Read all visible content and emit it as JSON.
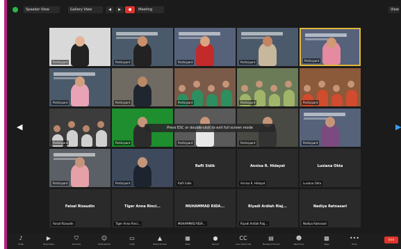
{
  "topbar": {
    "speaker_view_label": "Speaker View",
    "gallery_view_label": "Gallery View",
    "prev_label": "◀",
    "next_label": "▶",
    "record_label": "●",
    "meeting_label": "Meeting",
    "view_label": "View"
  },
  "notice": "Press ESC or double-click to exit full screen mode",
  "navigation": {
    "left": "◀",
    "right": "▶"
  },
  "tiles": [
    {
      "name": "Participant",
      "kind": "video",
      "bg": "#d9d9d9",
      "person": "#222222",
      "head": "#e3b597"
    },
    {
      "name": "Participant",
      "kind": "banner",
      "bg": "#4b5a6b",
      "person": "#222222",
      "head": "#c98f6b"
    },
    {
      "name": "Participant",
      "kind": "banner",
      "bg": "#55627a",
      "person": "#c32a2a",
      "head": "#d9a47f"
    },
    {
      "name": "Participant",
      "kind": "banner",
      "bg": "#4b5a6b",
      "person": "#c7b79c",
      "head": "#c48461"
    },
    {
      "name": "Participant",
      "kind": "banner",
      "bg": "#55627a",
      "person": "#e58aa0",
      "head": "#d09a74",
      "active": true
    },
    {
      "name": "Participant",
      "kind": "banner",
      "bg": "#4b5a6b",
      "person": "#e9a3b6",
      "head": "#d3a07e"
    },
    {
      "name": "Participant",
      "kind": "video",
      "bg": "#6f6a62",
      "person": "#1f2630",
      "head": "#b98866"
    },
    {
      "name": "Participant",
      "kind": "group",
      "bg": "#7a5a48",
      "person": "#2d8f5f",
      "head": "#c5957a"
    },
    {
      "name": "Participant",
      "kind": "group",
      "bg": "#6b7b58",
      "person": "#a0b56a",
      "head": "#c5957a"
    },
    {
      "name": "Participant",
      "kind": "group",
      "bg": "#8a5a3a",
      "person": "#d14b2f",
      "head": "#c5957a"
    },
    {
      "name": "Participant",
      "kind": "group",
      "bg": "#3c3c3c",
      "person": "#d0d0d0",
      "head": "#b8876b"
    },
    {
      "name": "Participant",
      "kind": "video",
      "bg": "#1e8e2e",
      "person": "#2c2c2c",
      "head": "#c5957a"
    },
    {
      "name": "Participant",
      "kind": "video",
      "bg": "#5a5a5a",
      "person": "#e8e8e8",
      "head": "#c5957a"
    },
    {
      "name": "Participant",
      "kind": "video",
      "bg": "#4a4a44",
      "person": "#333333",
      "head": "#c5957a"
    },
    {
      "name": "Participant",
      "kind": "banner",
      "bg": "#55627a",
      "person": "#7b4a7e",
      "head": "#c5957a"
    },
    {
      "name": "Participant",
      "kind": "banner",
      "bg": "#5b5f66",
      "person": "#e5a0a8",
      "head": "#c5957a"
    },
    {
      "name": "Participant",
      "kind": "video",
      "bg": "#3e4a5c",
      "person": "#1d2430",
      "head": "#c5957a"
    },
    {
      "name": "Rafli Sidik",
      "kind": "name"
    },
    {
      "name": "Annisa R. Hidayat",
      "kind": "name"
    },
    {
      "name": "Lusiana Okta",
      "kind": "name"
    },
    {
      "name": "Faisal Rizaudin",
      "kind": "name"
    },
    {
      "name": "Tiger Anna Rinci...",
      "kind": "name"
    },
    {
      "name": "MUHAMMAD RIDA...",
      "kind": "name"
    },
    {
      "name": "Riyadi Ardiah Riaj...",
      "kind": "name"
    },
    {
      "name": "Nadiya Ratnasari",
      "kind": "name"
    }
  ],
  "toolbar": [
    {
      "icon": "mic-icon",
      "glyph": "♪",
      "label": "Mute"
    },
    {
      "icon": "video-icon",
      "glyph": "▶",
      "label": "Stop Video"
    },
    {
      "icon": "security-icon",
      "glyph": "⛉",
      "label": "Security"
    },
    {
      "icon": "participants-icon",
      "glyph": "☺",
      "label": "Participants"
    },
    {
      "icon": "chat-icon",
      "glyph": "▭",
      "label": "Chat"
    },
    {
      "icon": "share-icon",
      "glyph": "▲",
      "label": "Share Screen"
    },
    {
      "icon": "polls-icon",
      "glyph": "▦",
      "label": "Polls"
    },
    {
      "icon": "record-icon",
      "glyph": "●",
      "label": "Record"
    },
    {
      "icon": "captions-icon",
      "glyph": "CC",
      "label": "Live Transcript"
    },
    {
      "icon": "breakout-icon",
      "glyph": "▤",
      "label": "Breakout Rooms"
    },
    {
      "icon": "reactions-icon",
      "glyph": "☻",
      "label": "Reactions"
    },
    {
      "icon": "apps-icon",
      "glyph": "▩",
      "label": "Apps"
    },
    {
      "icon": "more-icon",
      "glyph": "•••",
      "label": "More"
    }
  ],
  "end_label": "End",
  "colors": {
    "accent": "#e2b83b",
    "end_button": "#e0352b",
    "frame_border": "#b4247f",
    "secure": "#2fb34a"
  }
}
